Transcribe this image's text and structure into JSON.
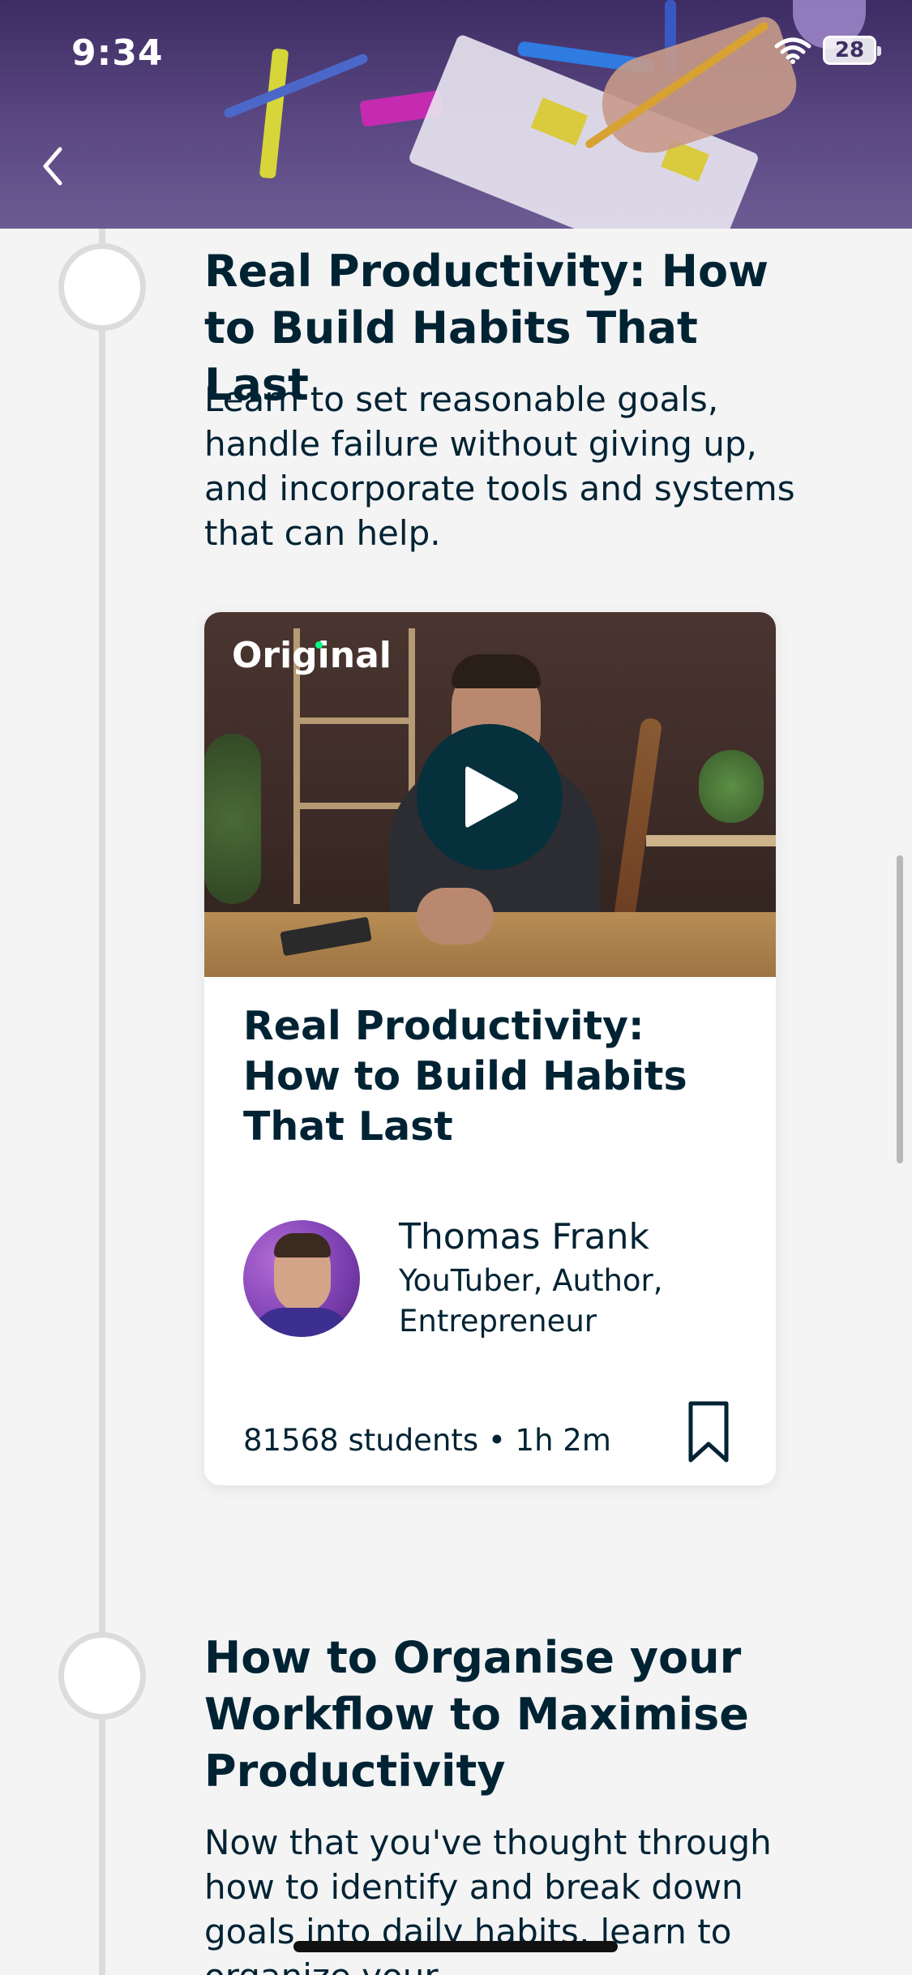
{
  "status_bar": {
    "time": "9:34",
    "battery": "28"
  },
  "lessons": [
    {
      "title": "Real Productivity: How to Build Habits That Last",
      "description": "Learn to set reasonable goals, handle failure without giving up, and incorporate tools and systems that can help."
    },
    {
      "title": "How to Organise your Workflow to Maximise Productivity",
      "description": "Now that you've thought through how to identify and break down goals into daily habits, learn to organize your"
    }
  ],
  "course_card": {
    "badge": "Original",
    "title": "Real Productivity: How to Build Habits That Last",
    "author_name": "Thomas Frank",
    "author_role": "YouTuber, Author, Entrepreneur",
    "meta": "81568 students • 1h 2m"
  },
  "colors": {
    "text": "#002333",
    "play_button": "#06303c",
    "timeline": "#dcdcdf",
    "background": "#f4f4f5",
    "badge_dot": "#00ff84"
  },
  "icons": [
    "back-chevron-icon",
    "wifi-icon",
    "battery-icon",
    "play-icon",
    "bookmark-icon"
  ]
}
